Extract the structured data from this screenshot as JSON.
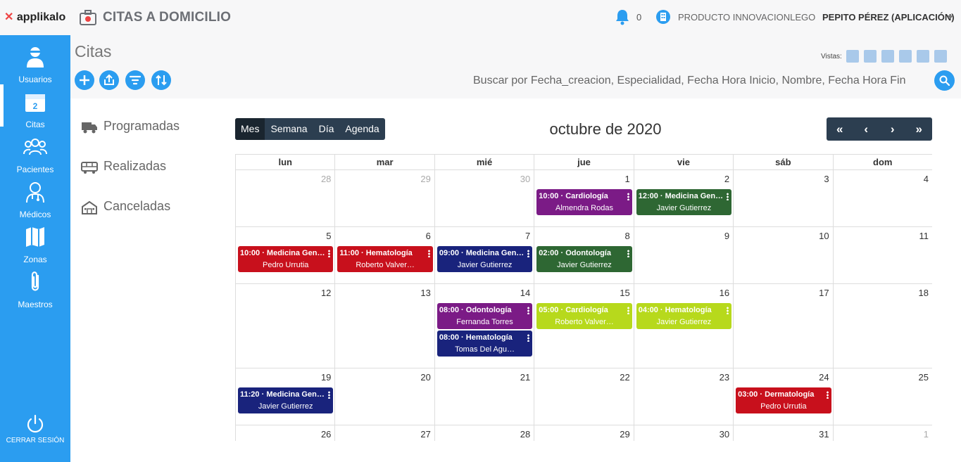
{
  "header": {
    "brand": "applikalo",
    "app_title": "CITAS A DOMICILIO",
    "notifications": "0",
    "product": "PRODUCTO INNOVACIONLEGO",
    "user": "PEPITO PÉREZ (APLICACIÓN)"
  },
  "sidebar": {
    "items": [
      {
        "label": "Usuarios",
        "icon": "user-icon"
      },
      {
        "label": "Citas",
        "icon": "calendar-icon",
        "badge": "2"
      },
      {
        "label": "Pacientes",
        "icon": "group-icon"
      },
      {
        "label": "Médicos",
        "icon": "doctor-icon"
      },
      {
        "label": "Zonas",
        "icon": "map-icon"
      },
      {
        "label": "Maestros",
        "icon": "paperclip-icon"
      }
    ],
    "logout": "CERRAR SESIÓN"
  },
  "page": {
    "title": "Citas",
    "vistas_label": "Vistas:",
    "search_placeholder": "Buscar por Fecha_creacion, Especialidad, Fecha Hora Inicio, Nombre, Fecha Hora Fin"
  },
  "filters": [
    {
      "label": "Programadas",
      "icon": "truck-icon"
    },
    {
      "label": "Realizadas",
      "icon": "bus-icon"
    },
    {
      "label": "Canceladas",
      "icon": "house-icon"
    }
  ],
  "calendar": {
    "views": [
      "Mes",
      "Semana",
      "Día",
      "Agenda"
    ],
    "title": "octubre de 2020",
    "nav": [
      "«",
      "‹",
      "›",
      "»"
    ],
    "weekdays": [
      "lun",
      "mar",
      "mié",
      "jue",
      "vie",
      "sáb",
      "dom"
    ],
    "weeks": [
      [
        "28",
        "29",
        "30",
        "1",
        "2",
        "3",
        "4"
      ],
      [
        "5",
        "6",
        "7",
        "8",
        "9",
        "10",
        "11"
      ],
      [
        "12",
        "13",
        "14",
        "15",
        "16",
        "17",
        "18"
      ],
      [
        "19",
        "20",
        "21",
        "22",
        "23",
        "24",
        "25"
      ],
      [
        "26",
        "27",
        "28",
        "29",
        "30",
        "31",
        "1"
      ]
    ],
    "events": [
      {
        "week": 0,
        "day": 3,
        "slot": 0,
        "time": "10:00",
        "title": "Cardiología",
        "person": "Almendra Rodas",
        "color": "#7b1b86"
      },
      {
        "week": 0,
        "day": 4,
        "slot": 0,
        "time": "12:00",
        "title": "Medicina Gen…",
        "person": "Javier Gutierrez",
        "color": "#2e6733"
      },
      {
        "week": 1,
        "day": 0,
        "slot": 0,
        "time": "10:00",
        "title": "Medicina Gen…",
        "person": "Pedro Urrutia",
        "color": "#c8101c"
      },
      {
        "week": 1,
        "day": 1,
        "slot": 0,
        "time": "11:00",
        "title": "Hematología",
        "person": "Roberto Valver…",
        "color": "#c8101c"
      },
      {
        "week": 1,
        "day": 2,
        "slot": 0,
        "time": "09:00",
        "title": "Medicina Gen…",
        "person": "Javier Gutierrez",
        "color": "#19237c"
      },
      {
        "week": 1,
        "day": 3,
        "slot": 0,
        "time": "02:00",
        "title": "Odontología",
        "person": "Javier Gutierrez",
        "color": "#2e6733"
      },
      {
        "week": 2,
        "day": 2,
        "slot": 0,
        "time": "08:00",
        "title": "Odontología",
        "person": "Fernanda Torres",
        "color": "#7b1b86"
      },
      {
        "week": 2,
        "day": 2,
        "slot": 1,
        "time": "08:00",
        "title": "Hematología",
        "person": "Tomas Del Agu…",
        "color": "#19237c"
      },
      {
        "week": 2,
        "day": 3,
        "slot": 0,
        "time": "05:00",
        "title": "Cardiología",
        "person": "Roberto Valver…",
        "color": "#b7d91c"
      },
      {
        "week": 2,
        "day": 4,
        "slot": 0,
        "time": "04:00",
        "title": "Hematología",
        "person": "Javier Gutierrez",
        "color": "#b7d91c"
      },
      {
        "week": 3,
        "day": 0,
        "slot": 0,
        "time": "11:20",
        "title": "Medicina Gen…",
        "person": "Javier Gutierrez",
        "color": "#19237c"
      },
      {
        "week": 3,
        "day": 5,
        "slot": 0,
        "time": "03:00",
        "title": "Dermatología",
        "person": "Pedro Urrutia",
        "color": "#c8101c"
      }
    ]
  }
}
